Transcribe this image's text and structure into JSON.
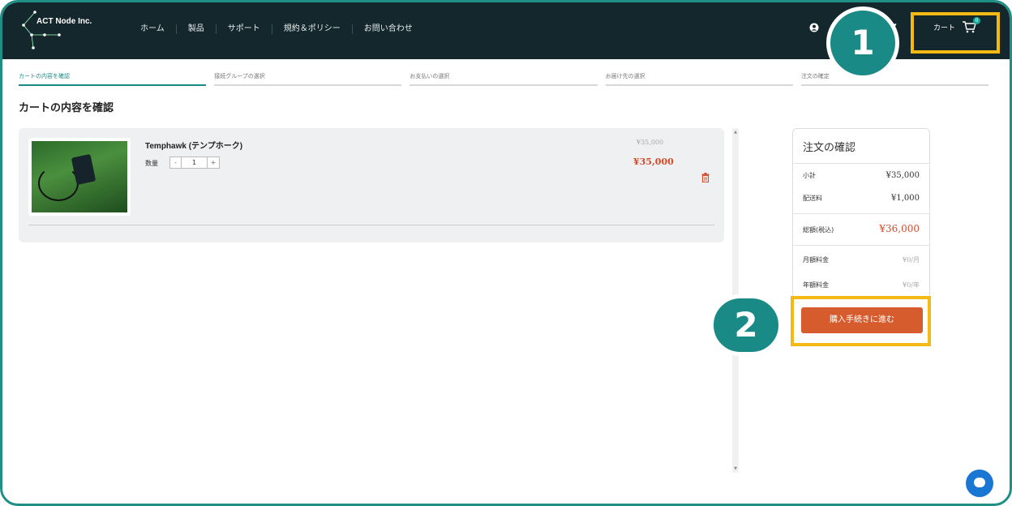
{
  "header": {
    "logo_text": "ACT Node Inc.",
    "nav": [
      "ホーム",
      "製品",
      "サポート",
      "規約＆ポリシー",
      "お問い合わせ"
    ],
    "cart_label": "カート",
    "cart_count": "0"
  },
  "markers": {
    "one": "1",
    "two": "2"
  },
  "steps": [
    "カートの内容を確認",
    "接続グループの選択",
    "お支払いの選択",
    "お届け先の選択",
    "注文の確定"
  ],
  "page_title": "カートの内容を確認",
  "cart_item": {
    "name": "Temphawk (テンプホーク)",
    "qty_label": "数量",
    "qty_minus": "-",
    "qty_value": "1",
    "qty_plus": "+",
    "price_original": "¥35,000",
    "price": "¥35,000"
  },
  "summary": {
    "title": "注文の確認",
    "subtotal_label": "小計",
    "subtotal": "¥35,000",
    "shipping_label": "配送料",
    "shipping": "¥1,000",
    "total_label": "総額(税込)",
    "total": "¥36,000",
    "monthly_label": "月額料金",
    "monthly": "¥0/月",
    "yearly_label": "年額料金",
    "yearly": "¥0/年",
    "checkout_label": "購入手続きに進む"
  },
  "colors": {
    "accent": "#1a8a87",
    "header": "#14272d",
    "price": "#d34b2a",
    "button": "#d65b2d",
    "highlight": "#f5b914"
  }
}
